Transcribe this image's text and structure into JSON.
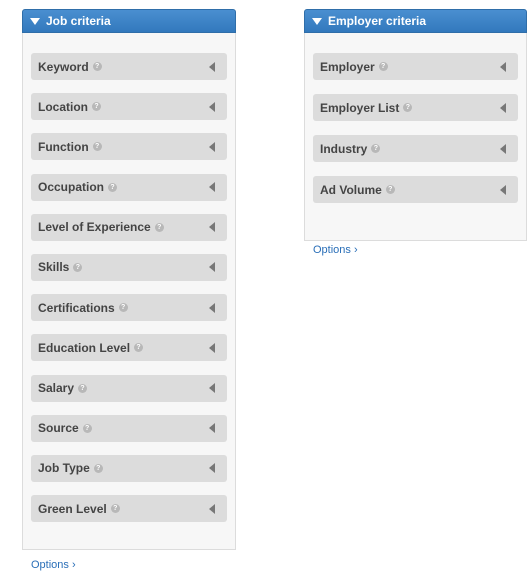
{
  "job_panel": {
    "title": "Job criteria",
    "items": [
      {
        "label": "Keyword"
      },
      {
        "label": "Location"
      },
      {
        "label": "Function"
      },
      {
        "label": "Occupation"
      },
      {
        "label": "Level of Experience"
      },
      {
        "label": "Skills"
      },
      {
        "label": "Certifications"
      },
      {
        "label": "Education Level"
      },
      {
        "label": "Salary"
      },
      {
        "label": "Source"
      },
      {
        "label": "Job Type"
      },
      {
        "label": "Green Level"
      }
    ],
    "options_label": "Options ›"
  },
  "employer_panel": {
    "title": "Employer criteria",
    "items": [
      {
        "label": "Employer"
      },
      {
        "label": "Employer List"
      },
      {
        "label": "Industry"
      },
      {
        "label": "Ad Volume"
      }
    ],
    "options_label": "Options ›"
  },
  "icons": {
    "help": "?",
    "panel_toggle": "caret-down-icon",
    "item_expand": "caret-left-icon"
  },
  "colors": {
    "header_blue": "#3a82c6",
    "item_bg": "#dcdcdc",
    "link": "#2a6fb8"
  }
}
